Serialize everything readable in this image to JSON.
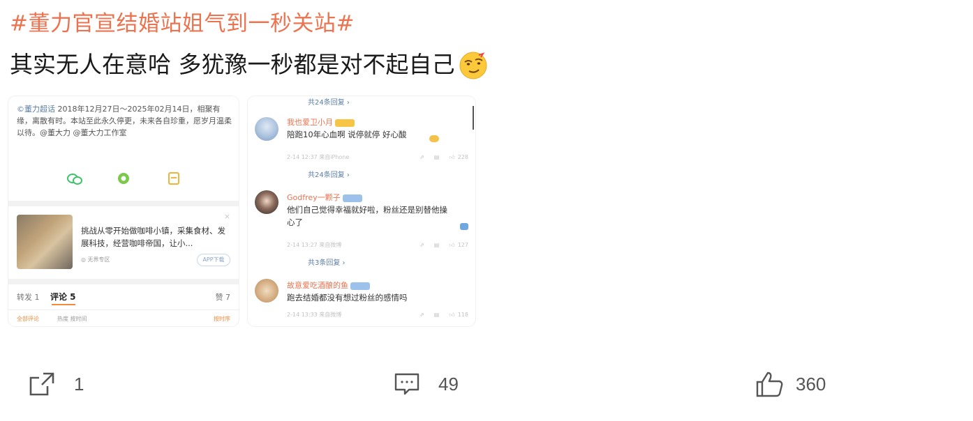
{
  "post": {
    "hashtag": "#董力官宣结婚站姐气到一秒关站#",
    "text": "其实无人在意哈 多犹豫一秒都是对不起自己",
    "emoji_icon": "smirk-emoji-icon"
  },
  "left_card": {
    "announcement": {
      "handle": "©董力超话",
      "body": "2018年12月27日～2025年02月14日，相聚有缘，离散有时。本站至此永久停更，未来各自珍重，愿岁月温柔以待。@董大力 @董大力工作室"
    },
    "share_icons": [
      "wechat-icon",
      "moments-icon",
      "bookmark-icon"
    ],
    "ad": {
      "text": "挑战从零开始做咖啡小镇，采集食材、发展科技，经营咖啡帝国，让小...",
      "meta": "◎ 无界专区",
      "button": "APP下载"
    },
    "tabs": {
      "repost": "转发 1",
      "comment": "评论 5",
      "like": "赞 7"
    },
    "filters": {
      "all": "全部评论",
      "hot": "热度 按时间",
      "sort": "按时序"
    }
  },
  "right_card": {
    "top_reply_link": "共24条回复 ›",
    "comments": [
      {
        "user": "我也爱卫小月",
        "text": "陪跑10年心血啊 说停就停 好心酸",
        "meta": "2-14 12:37 来自iPhone",
        "likes": "228",
        "reply_link": "共24条回复 ›"
      },
      {
        "user": "Godfrey一颗子",
        "text": "他们自己觉得幸福就好啦，粉丝还是别替他操心了",
        "meta": "2-14 13:27 来自微博",
        "likes": "127",
        "reply_link": "共3条回复 ›"
      },
      {
        "user": "故意爱吃酒酿的鱼",
        "text": "跑去结婚都没有想过粉丝的感情吗",
        "meta": "2-14 13:33 来自微博",
        "likes": "118"
      }
    ]
  },
  "actions": {
    "repost_count": "1",
    "comment_count": "49",
    "like_count": "360"
  }
}
